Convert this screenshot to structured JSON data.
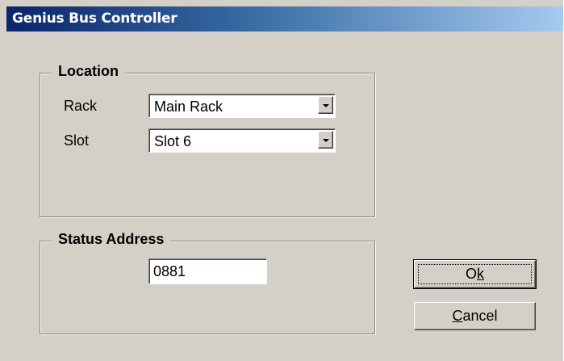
{
  "window": {
    "title": "Genius Bus Controller"
  },
  "location_group": {
    "legend": "Location",
    "rack_label": "Rack",
    "rack_value": "Main Rack",
    "slot_label": "Slot",
    "slot_value": "Slot 6"
  },
  "status_group": {
    "legend": "Status Address",
    "address_value": "0881"
  },
  "buttons": {
    "ok_pre": "O",
    "ok_mnemonic": "k",
    "ok_post": "",
    "cancel_pre": "",
    "cancel_mnemonic": "C",
    "cancel_post": "ancel"
  },
  "colors": {
    "dialog_bg": "#d4d0c8",
    "title_start": "#0a246a",
    "title_end": "#a6caf0"
  },
  "icons": {
    "dropdown": "chevron-down-icon"
  }
}
